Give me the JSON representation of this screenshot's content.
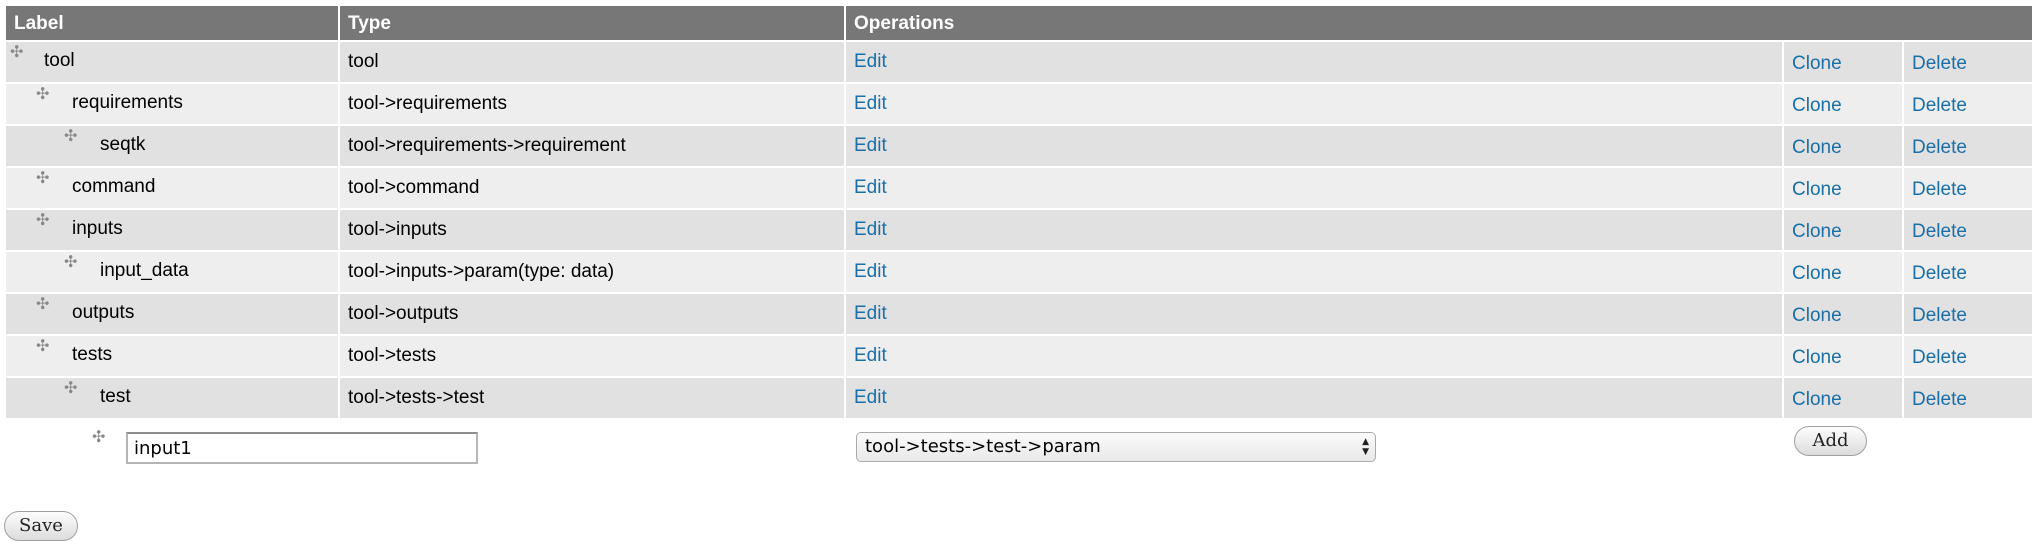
{
  "header": {
    "label_col": "Label",
    "type_col": "Type",
    "operations_col": "Operations"
  },
  "rows": [
    {
      "label": "tool",
      "depth": 0,
      "type": "tool",
      "edit": "Edit",
      "clone": "Clone",
      "delete": "Delete"
    },
    {
      "label": "requirements",
      "depth": 1,
      "type": "tool->requirements",
      "edit": "Edit",
      "clone": "Clone",
      "delete": "Delete"
    },
    {
      "label": "seqtk",
      "depth": 2,
      "type": "tool->requirements->requirement",
      "edit": "Edit",
      "clone": "Clone",
      "delete": "Delete"
    },
    {
      "label": "command",
      "depth": 1,
      "type": "tool->command",
      "edit": "Edit",
      "clone": "Clone",
      "delete": "Delete"
    },
    {
      "label": "inputs",
      "depth": 1,
      "type": "tool->inputs",
      "edit": "Edit",
      "clone": "Clone",
      "delete": "Delete"
    },
    {
      "label": "input_data",
      "depth": 2,
      "type": "tool->inputs->param(type: data)",
      "edit": "Edit",
      "clone": "Clone",
      "delete": "Delete"
    },
    {
      "label": "outputs",
      "depth": 1,
      "type": "tool->outputs",
      "edit": "Edit",
      "clone": "Clone",
      "delete": "Delete"
    },
    {
      "label": "tests",
      "depth": 1,
      "type": "tool->tests",
      "edit": "Edit",
      "clone": "Clone",
      "delete": "Delete"
    },
    {
      "label": "test",
      "depth": 2,
      "type": "tool->tests->test",
      "edit": "Edit",
      "clone": "Clone",
      "delete": "Delete"
    }
  ],
  "new_item": {
    "label_value": "input1",
    "type_selected": "tool->tests->test->param",
    "add_label": "Add"
  },
  "save_label": "Save",
  "icons": {
    "drag_handle": "move-icon",
    "select_arrows": "updown-arrows-icon"
  },
  "colors": {
    "header_bg": "#777777",
    "row_dark": "#e1e1e1",
    "row_light": "#eeeeee",
    "link": "#1a6fa8"
  }
}
